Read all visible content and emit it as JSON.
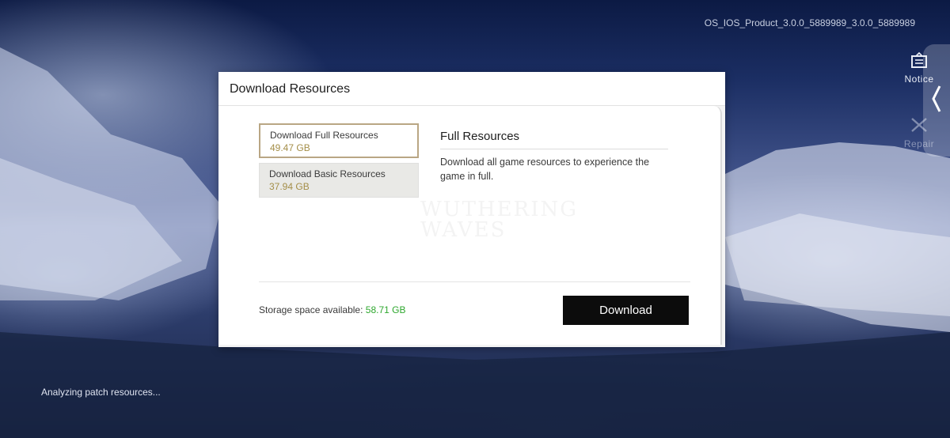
{
  "version_text": "OS_IOS_Product_3.0.0_5889989_3.0.0_5889989",
  "side_menu": {
    "notice": {
      "label": "Notice",
      "icon": "notice-icon"
    },
    "repair": {
      "label": "Repair",
      "icon": "wrench-icon"
    },
    "collapse_icon": "chevron-left-icon"
  },
  "status_text": "Analyzing patch resources...",
  "dialog": {
    "title": "Download Resources",
    "options": [
      {
        "label": "Download Full Resources",
        "size": "49.47 GB",
        "selected": true
      },
      {
        "label": "Download Basic Resources",
        "size": "37.94 GB",
        "selected": false
      }
    ],
    "detail": {
      "title": "Full Resources",
      "description": "Download all game resources to experience the game in full."
    },
    "storage": {
      "label": "Storage space available:",
      "value": "58.71 GB"
    },
    "download_label": "Download"
  },
  "colors": {
    "selected_border": "#b9a684",
    "size_text": "#a48e48",
    "storage_value": "#2fa82f",
    "button_bg": "#0c0c0c"
  }
}
